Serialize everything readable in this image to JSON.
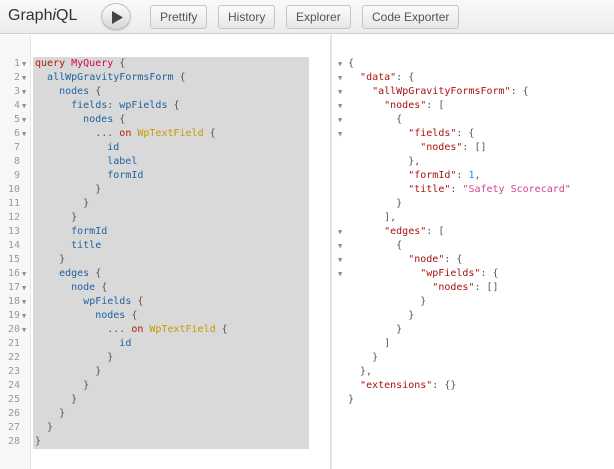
{
  "toolbar": {
    "logo_main": "Graph",
    "logo_italic": "i",
    "logo_end": "QL",
    "buttons": [
      "Prettify",
      "History",
      "Explorer",
      "Code Exporter"
    ]
  },
  "editor": {
    "lines": [
      [
        [
          "query ",
          "kw"
        ],
        [
          "MyQuery",
          "def"
        ],
        [
          " {",
          "punct"
        ]
      ],
      [
        [
          "  ",
          "punct"
        ],
        [
          "allWpGravityFormsForm",
          "fld"
        ],
        [
          " {",
          "punct"
        ]
      ],
      [
        [
          "    ",
          "punct"
        ],
        [
          "nodes",
          "fld"
        ],
        [
          " {",
          "punct"
        ]
      ],
      [
        [
          "      ",
          "punct"
        ],
        [
          "fields",
          "fld"
        ],
        [
          ": ",
          "punct"
        ],
        [
          "wpFields",
          "attr"
        ],
        [
          " {",
          "punct"
        ]
      ],
      [
        [
          "        ",
          "punct"
        ],
        [
          "nodes",
          "fld"
        ],
        [
          " {",
          "punct"
        ]
      ],
      [
        [
          "          ... ",
          "punct"
        ],
        [
          "on ",
          "kw"
        ],
        [
          "WpTextField",
          "typ"
        ],
        [
          " {",
          "punct"
        ]
      ],
      [
        [
          "            ",
          "punct"
        ],
        [
          "id",
          "fld"
        ]
      ],
      [
        [
          "            ",
          "punct"
        ],
        [
          "label",
          "fld"
        ]
      ],
      [
        [
          "            ",
          "punct"
        ],
        [
          "formId",
          "fld"
        ]
      ],
      [
        [
          "          }",
          "punct"
        ]
      ],
      [
        [
          "        }",
          "punct"
        ]
      ],
      [
        [
          "      }",
          "punct"
        ]
      ],
      [
        [
          "      ",
          "punct"
        ],
        [
          "formId",
          "fld"
        ]
      ],
      [
        [
          "      ",
          "punct"
        ],
        [
          "title",
          "fld"
        ]
      ],
      [
        [
          "    }",
          "punct"
        ]
      ],
      [
        [
          "    ",
          "punct"
        ],
        [
          "edges",
          "fld"
        ],
        [
          " {",
          "punct"
        ]
      ],
      [
        [
          "      ",
          "punct"
        ],
        [
          "node",
          "fld"
        ],
        [
          " {",
          "punct"
        ]
      ],
      [
        [
          "        ",
          "punct"
        ],
        [
          "wpFields",
          "fld"
        ],
        [
          " {",
          "punct"
        ]
      ],
      [
        [
          "          ",
          "punct"
        ],
        [
          "nodes",
          "fld"
        ],
        [
          " {",
          "punct"
        ]
      ],
      [
        [
          "            ... ",
          "punct"
        ],
        [
          "on ",
          "kw"
        ],
        [
          "WpTextField",
          "typ"
        ],
        [
          " {",
          "punct"
        ]
      ],
      [
        [
          "              ",
          "punct"
        ],
        [
          "id",
          "fld"
        ]
      ],
      [
        [
          "            }",
          "punct"
        ]
      ],
      [
        [
          "          }",
          "punct"
        ]
      ],
      [
        [
          "        }",
          "punct"
        ]
      ],
      [
        [
          "      }",
          "punct"
        ]
      ],
      [
        [
          "    }",
          "punct"
        ]
      ],
      [
        [
          "  }",
          "punct"
        ]
      ],
      [
        [
          "}",
          "punct"
        ]
      ]
    ],
    "line_numbers": [
      "1",
      "2",
      "3",
      "4",
      "5",
      "6",
      "7",
      "8",
      "9",
      "10",
      "11",
      "12",
      "13",
      "14",
      "15",
      "16",
      "17",
      "18",
      "19",
      "20",
      "21",
      "22",
      "23",
      "24",
      "25",
      "26",
      "27",
      "28"
    ],
    "fold_lines": [
      1,
      2,
      3,
      4,
      5,
      6,
      16,
      17,
      18,
      19,
      20
    ]
  },
  "result": {
    "lines": [
      [
        [
          "{",
          "punct"
        ]
      ],
      [
        [
          "  ",
          "punct"
        ],
        [
          "\"data\"",
          "key"
        ],
        [
          ": {",
          "punct"
        ]
      ],
      [
        [
          "    ",
          "punct"
        ],
        [
          "\"allWpGravityFormsForm\"",
          "key"
        ],
        [
          ": {",
          "punct"
        ]
      ],
      [
        [
          "      ",
          "punct"
        ],
        [
          "\"nodes\"",
          "key"
        ],
        [
          ": [",
          "punct"
        ]
      ],
      [
        [
          "        {",
          "punct"
        ]
      ],
      [
        [
          "          ",
          "punct"
        ],
        [
          "\"fields\"",
          "key"
        ],
        [
          ": {",
          "punct"
        ]
      ],
      [
        [
          "            ",
          "punct"
        ],
        [
          "\"nodes\"",
          "key"
        ],
        [
          ": []",
          "punct"
        ]
      ],
      [
        [
          "          },",
          "punct"
        ]
      ],
      [
        [
          "          ",
          "punct"
        ],
        [
          "\"formId\"",
          "key"
        ],
        [
          ": ",
          "punct"
        ],
        [
          "1",
          "num"
        ],
        [
          ",",
          "punct"
        ]
      ],
      [
        [
          "          ",
          "punct"
        ],
        [
          "\"title\"",
          "key"
        ],
        [
          ": ",
          "punct"
        ],
        [
          "\"Safety Scorecard\"",
          "str"
        ]
      ],
      [
        [
          "        }",
          "punct"
        ]
      ],
      [
        [
          "      ],",
          "punct"
        ]
      ],
      [
        [
          "      ",
          "punct"
        ],
        [
          "\"edges\"",
          "key"
        ],
        [
          ": [",
          "punct"
        ]
      ],
      [
        [
          "        {",
          "punct"
        ]
      ],
      [
        [
          "          ",
          "punct"
        ],
        [
          "\"node\"",
          "key"
        ],
        [
          ": {",
          "punct"
        ]
      ],
      [
        [
          "            ",
          "punct"
        ],
        [
          "\"wpFields\"",
          "key"
        ],
        [
          ": {",
          "punct"
        ]
      ],
      [
        [
          "              ",
          "punct"
        ],
        [
          "\"nodes\"",
          "key"
        ],
        [
          ": []",
          "punct"
        ]
      ],
      [
        [
          "            }",
          "punct"
        ]
      ],
      [
        [
          "          }",
          "punct"
        ]
      ],
      [
        [
          "        }",
          "punct"
        ]
      ],
      [
        [
          "      ]",
          "punct"
        ]
      ],
      [
        [
          "    }",
          "punct"
        ]
      ],
      [
        [
          "  },",
          "punct"
        ]
      ],
      [
        [
          "  ",
          "punct"
        ],
        [
          "\"extensions\"",
          "key"
        ],
        [
          ": {}",
          "punct"
        ]
      ],
      [
        [
          "}",
          "punct"
        ]
      ]
    ],
    "fold_lines": [
      1,
      2,
      3,
      4,
      5,
      6,
      13,
      14,
      15,
      16
    ]
  }
}
